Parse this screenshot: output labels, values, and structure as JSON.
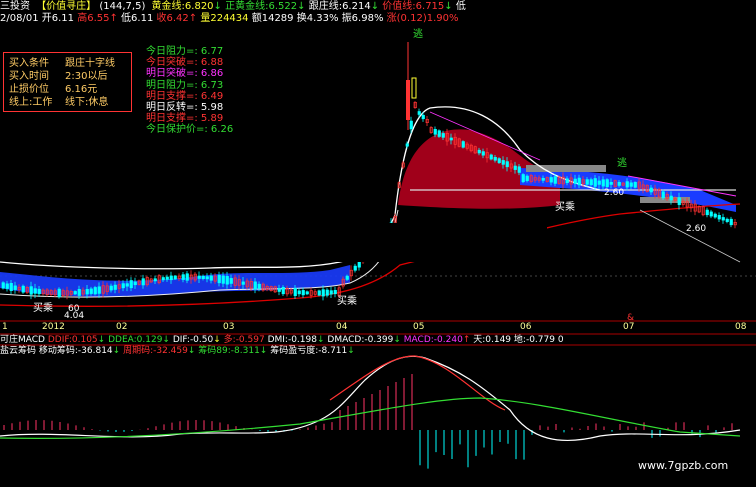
{
  "header": {
    "title": "三投资",
    "indicator_name": "【价值寻庄】",
    "params": "(144,7,5)",
    "gold_line": "黄金线:6.820",
    "gold_arrow": "↓",
    "positive_gold_line": "正黄金线:6.522",
    "positive_gold_arrow": "↓",
    "follow_line": "跟庄线:6.214",
    "follow_arrow": "↓",
    "value_line": "价值线:6.715",
    "value_arrow": "↓",
    "value_tail": "低"
  },
  "quote": {
    "date": "2/08/01",
    "open": "开6.11",
    "high": "高6.55",
    "high_arrow": "↑",
    "low": "低6.11",
    "close": "收6.42",
    "close_arrow": "↑",
    "volume": "量224434",
    "amount": "额14289",
    "turnover": "换4.33%",
    "amplitude": "振6.98%",
    "change": "涨(0.12)1.90%"
  },
  "buy_panel": {
    "rows": [
      {
        "label": "买入条件",
        "value": "跟庄十字线"
      },
      {
        "label": "买入时间",
        "value": "2:30以后"
      },
      {
        "label": "止损价位",
        "value": "6.16元"
      },
      {
        "label": "线上:工作",
        "value": "线下:休息"
      }
    ]
  },
  "levels": [
    {
      "text": "今日阻力=: 6.77",
      "color": "#33dd33"
    },
    {
      "text": "今日突破=: 6.88",
      "color": "#ff3333"
    },
    {
      "text": "明日突破=: 6.86",
      "color": "#ff33ff"
    },
    {
      "text": "明日阻力=: 6.73",
      "color": "#33dd33"
    },
    {
      "text": "明日支撑=: 6.49",
      "color": "#ff3333"
    },
    {
      "text": "明日反转=: 5.98",
      "color": "#ffffff"
    },
    {
      "text": "明日支撑=: 5.89",
      "color": "#ff3333"
    },
    {
      "text": "今日保护价=: 6.26",
      "color": "#33dd33"
    }
  ],
  "annotations": {
    "sell_top": "逃",
    "sell_right": "逃",
    "buy_mid": "买乘",
    "buy_left": "买乘",
    "buy_bottom": "买乘",
    "price_low": "4.04",
    "price_60a": "60",
    "price_60b": "2.60",
    "price_60c": "2.60",
    "price_b4": "2.60"
  },
  "x_axis": {
    "labels": [
      "1",
      "2012",
      "02",
      "03",
      "04",
      "05",
      "06",
      "07",
      "08"
    ],
    "marker": "&"
  },
  "macd_header": {
    "name": "可庄MACD",
    "dif": "DDIF:0.105",
    "dif_arrow": "↓",
    "dea": "DDEA:0.129",
    "dea_arrow": "↓",
    "dif2": "DIF:-0.50",
    "dif2_arrow": "↓",
    "duo": "多:-0.597",
    "dmi": "DMI:-0.198",
    "dmi_arrow": "↓",
    "dmacd": "DMACD:-0.399",
    "dmacd_arrow": "↓",
    "macd": "MACD:-0.240",
    "macd_arrow": "↑",
    "sky": "天:0.149",
    "ground": "地:-0.779",
    "tail": "0"
  },
  "chips_header": {
    "name": "盐云筹码",
    "move": "移动筹码:-36.814",
    "move_arrow": "↓",
    "cycle": "周期码:-32.459",
    "cycle_arrow": "↓",
    "chip89": "筹码89:-8.311",
    "chip89_arrow": "↓",
    "chip_pl": "筹码盈亏度:-8.711",
    "chip_pl_arrow": "↓"
  },
  "watermark": "www.7gpzb.com",
  "colors": {
    "up": "#ff3333",
    "down": "#00ffff",
    "gold": "#ffff00",
    "green": "#33dd33",
    "magenta": "#ff33ff",
    "band_blue": "#1a3cff",
    "band_red": "#a0001a"
  },
  "chart_data": {
    "type": "line",
    "x": [
      "2012-01",
      "2012-02",
      "2012-03",
      "2012-04",
      "2012-05",
      "2012-06",
      "2012-07",
      "2012-08"
    ],
    "series": [],
    "ylabel": "",
    "xlabel": ""
  }
}
